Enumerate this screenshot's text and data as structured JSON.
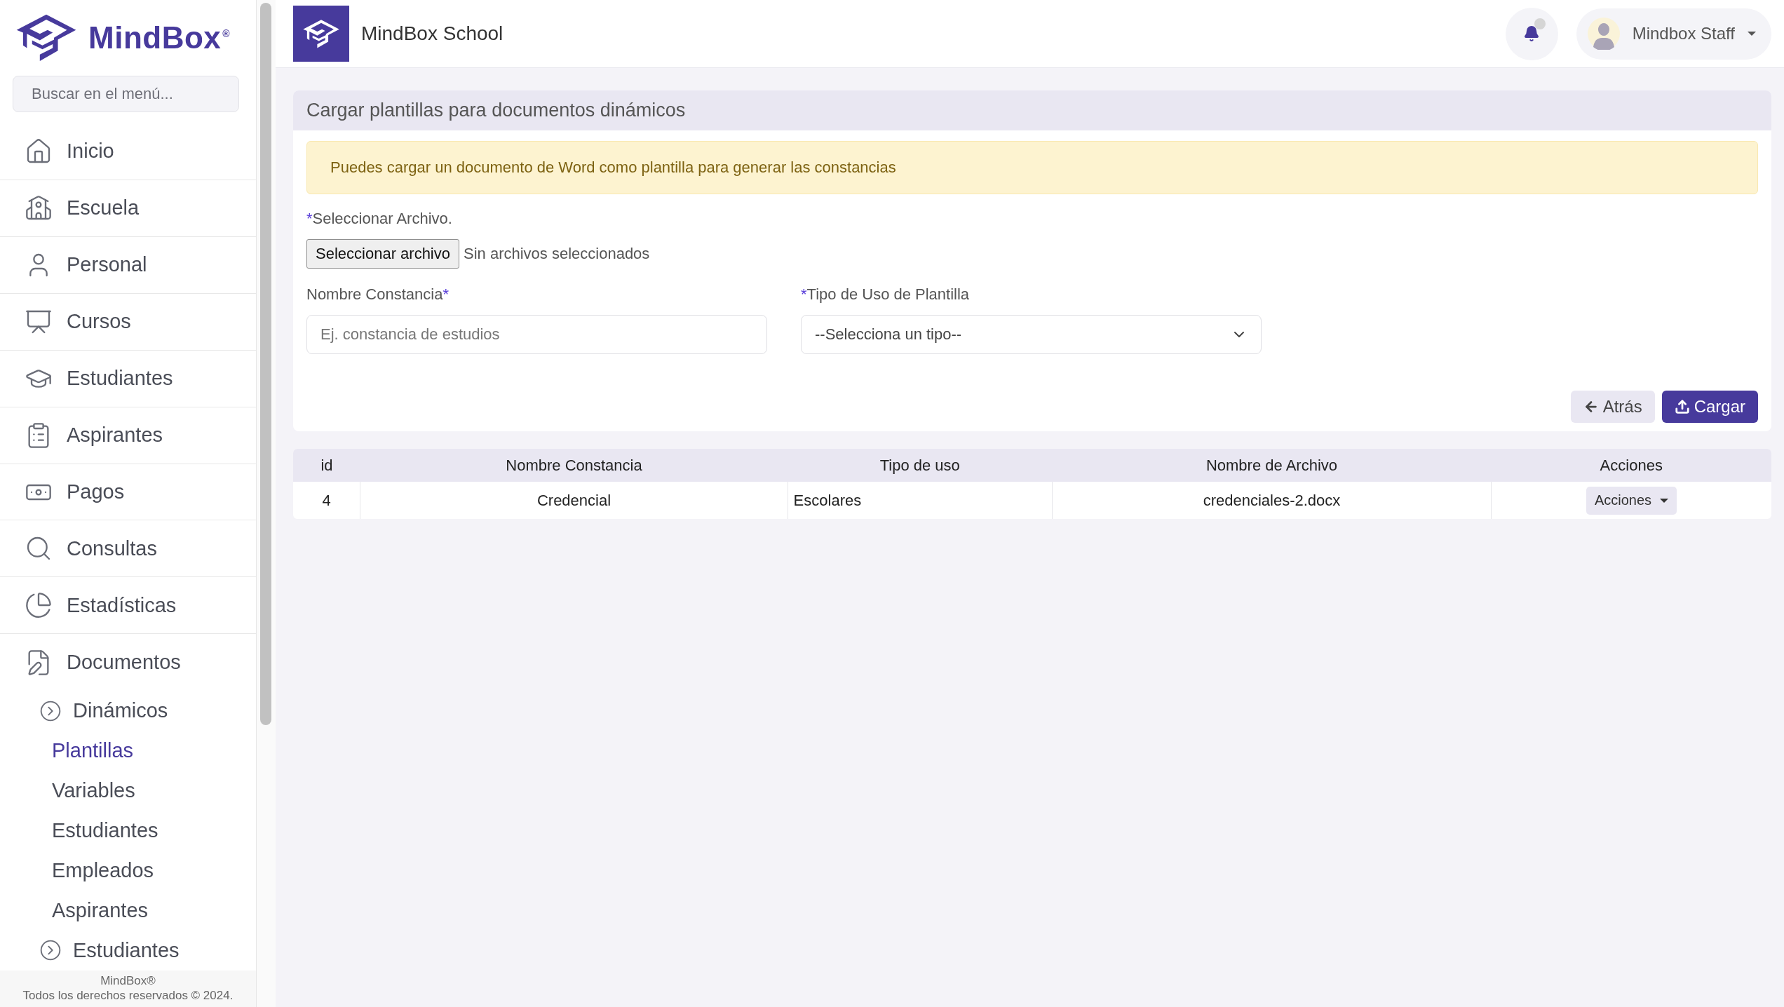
{
  "sidebar": {
    "brand": "MindBox",
    "brand_mark": "®",
    "search": {
      "placeholder": "Buscar en el menú..."
    },
    "items": [
      {
        "label": "Inicio"
      },
      {
        "label": "Escuela"
      },
      {
        "label": "Personal"
      },
      {
        "label": "Cursos"
      },
      {
        "label": "Estudiantes"
      },
      {
        "label": "Aspirantes"
      },
      {
        "label": "Pagos"
      },
      {
        "label": "Consultas"
      },
      {
        "label": "Estadísticas"
      },
      {
        "label": "Documentos",
        "children": [
          {
            "label": "Dinámicos",
            "children": [
              {
                "label": "Plantillas",
                "selected": true
              },
              {
                "label": "Variables",
                "selected": false
              },
              {
                "label": "Estudiantes",
                "selected": false
              },
              {
                "label": "Empleados",
                "selected": false
              },
              {
                "label": "Aspirantes",
                "selected": false
              }
            ]
          },
          {
            "label": "Estudiantes"
          }
        ]
      }
    ],
    "footer": [
      "MindBox®",
      "Todos los derechos reservados © 2024."
    ]
  },
  "header": {
    "title": "MindBox School",
    "user": "Mindbox Staff"
  },
  "card": {
    "title": "Cargar plantillas para documentos dinámicos",
    "alert": "Puedes cargar un documento de Word como plantilla para generar las constancias",
    "file": {
      "label": "Seleccionar Archivo.",
      "mark": "*",
      "mark_first": true,
      "button": "Seleccionar archivo",
      "status": "Sin archivos seleccionados"
    },
    "fields": [
      {
        "kind": "text",
        "label": "Nombre Constancia",
        "mark": "*",
        "mark_first": false,
        "placeholder": "Ej. constancia de estudios"
      },
      {
        "kind": "select",
        "label": "Tipo de Uso de Plantilla",
        "mark": "*",
        "mark_first": true,
        "value": "--Selecciona un tipo--"
      }
    ],
    "buttons": [
      {
        "kind": "back",
        "label": "Atrás"
      },
      {
        "kind": "upload",
        "label": "Cargar"
      }
    ]
  },
  "table": {
    "columns": [
      "id",
      "Nombre Constancia",
      "Tipo de uso",
      "Nombre de Archivo",
      "Acciones"
    ],
    "rows": [
      {
        "cells": [
          "4",
          "Credencial",
          "Escolares",
          "credenciales-2.docx"
        ],
        "action": "Acciones"
      }
    ]
  }
}
